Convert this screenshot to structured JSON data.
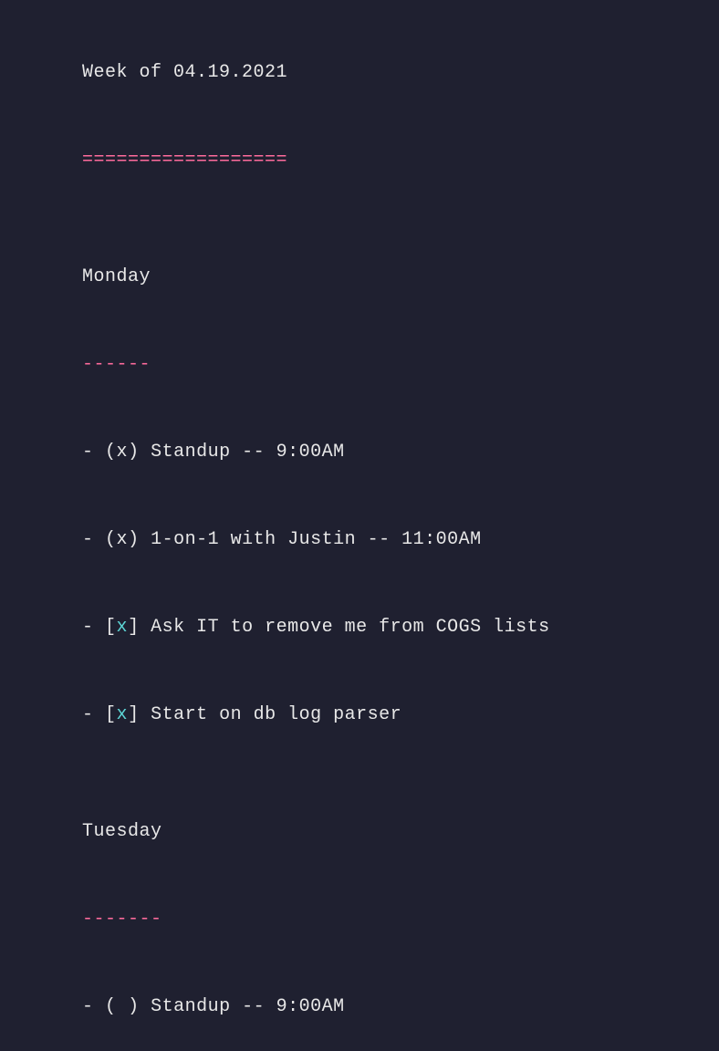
{
  "title": "Week of 04.19.2021",
  "title_underline": "==================",
  "days": [
    {
      "name": "Monday",
      "underline": "------",
      "items": [
        {
          "bullet": "- ",
          "checkbox_open": "(",
          "checkbox_mark": "x",
          "checkbox_close": ")",
          "text": " Standup -- 9:00AM",
          "mark_color": "white"
        },
        {
          "bullet": "- ",
          "checkbox_open": "(",
          "checkbox_mark": "x",
          "checkbox_close": ")",
          "text": " 1-on-1 with Justin -- 11:00AM",
          "mark_color": "white"
        },
        {
          "bullet": "- ",
          "checkbox_open": "[",
          "checkbox_mark": "x",
          "checkbox_close": "]",
          "text": " Ask IT to remove me from COGS lists",
          "mark_color": "cyan"
        },
        {
          "bullet": "- ",
          "checkbox_open": "[",
          "checkbox_mark": "x",
          "checkbox_close": "]",
          "text": " Start on db log parser",
          "mark_color": "cyan"
        }
      ]
    },
    {
      "name": "Tuesday",
      "underline": "-------",
      "items": [
        {
          "bullet": "- ",
          "checkbox_open": "(",
          "checkbox_mark": " ",
          "checkbox_close": ")",
          "text": " Standup -- 9:00AM",
          "mark_color": "white"
        }
      ]
    }
  ]
}
